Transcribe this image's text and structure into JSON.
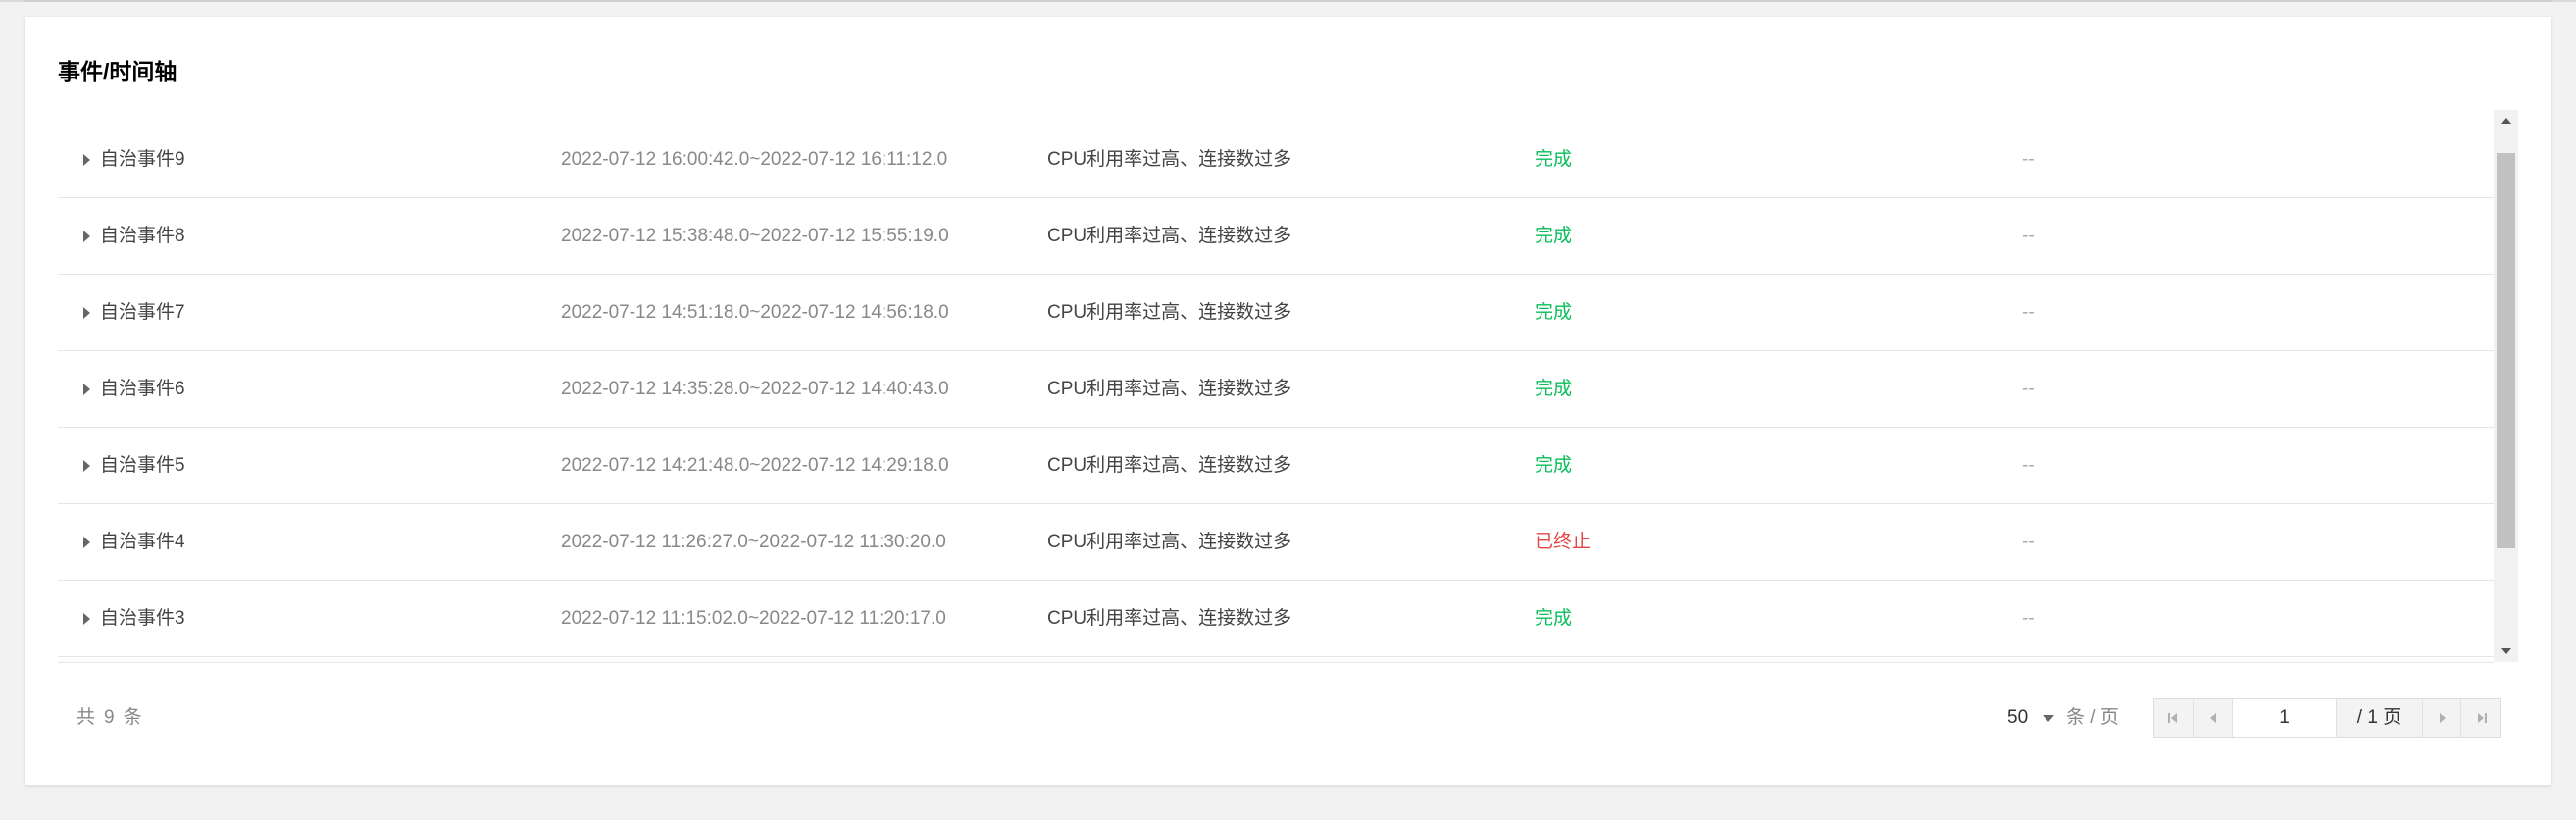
{
  "card": {
    "title": "事件/时间轴"
  },
  "events": [
    {
      "name": "自治事件9",
      "time": "2022-07-12 16:00:42.0~2022-07-12 16:11:12.0",
      "reason": "CPU利用率过高、连接数过多",
      "status": "完成",
      "status_type": "ok",
      "extra": "--"
    },
    {
      "name": "自治事件8",
      "time": "2022-07-12 15:38:48.0~2022-07-12 15:55:19.0",
      "reason": "CPU利用率过高、连接数过多",
      "status": "完成",
      "status_type": "ok",
      "extra": "--"
    },
    {
      "name": "自治事件7",
      "time": "2022-07-12 14:51:18.0~2022-07-12 14:56:18.0",
      "reason": "CPU利用率过高、连接数过多",
      "status": "完成",
      "status_type": "ok",
      "extra": "--"
    },
    {
      "name": "自治事件6",
      "time": "2022-07-12 14:35:28.0~2022-07-12 14:40:43.0",
      "reason": "CPU利用率过高、连接数过多",
      "status": "完成",
      "status_type": "ok",
      "extra": "--"
    },
    {
      "name": "自治事件5",
      "time": "2022-07-12 14:21:48.0~2022-07-12 14:29:18.0",
      "reason": "CPU利用率过高、连接数过多",
      "status": "完成",
      "status_type": "ok",
      "extra": "--"
    },
    {
      "name": "自治事件4",
      "time": "2022-07-12 11:26:27.0~2022-07-12 11:30:20.0",
      "reason": "CPU利用率过高、连接数过多",
      "status": "已终止",
      "status_type": "stopped",
      "extra": "--"
    },
    {
      "name": "自治事件3",
      "time": "2022-07-12 11:15:02.0~2022-07-12 11:20:17.0",
      "reason": "CPU利用率过高、连接数过多",
      "status": "完成",
      "status_type": "ok",
      "extra": "--"
    }
  ],
  "colors": {
    "status_ok": "#0abf5b",
    "status_stopped": "#e54545"
  },
  "footer": {
    "total_prefix": "共",
    "total_count": "9",
    "total_suffix": "条",
    "page_size": "50",
    "page_size_unit": "条 / 页",
    "current_page": "1",
    "page_total": "/ 1 页"
  },
  "icons": {
    "expand": "caret-right-icon",
    "first": "first-page-icon",
    "prev": "prev-page-icon",
    "next": "next-page-icon",
    "last": "last-page-icon",
    "dropdown": "chevron-down-icon"
  }
}
